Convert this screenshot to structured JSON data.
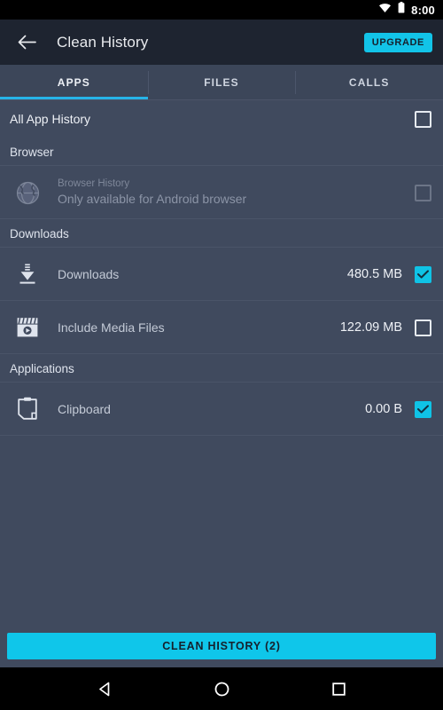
{
  "status_bar": {
    "time": "8:00",
    "wifi_icon": "wifi-icon",
    "battery_icon": "battery-icon"
  },
  "app_bar": {
    "back_icon": "back-arrow-icon",
    "title": "Clean History",
    "upgrade_label": "UPGRADE"
  },
  "tabs": {
    "active_index": 0,
    "items": [
      {
        "label": "APPS"
      },
      {
        "label": "FILES"
      },
      {
        "label": "CALLS"
      }
    ]
  },
  "all_app_history": {
    "label": "All App History",
    "checked": false
  },
  "sections": [
    {
      "header": "Browser",
      "rows": [
        {
          "icon": "globe-icon",
          "title": "Browser History",
          "subtitle": "Only available for Android browser",
          "size": "",
          "checked": false,
          "disabled": true
        }
      ]
    },
    {
      "header": "Downloads",
      "rows": [
        {
          "icon": "download-icon",
          "title": "Downloads",
          "subtitle": "",
          "size": "480.5 MB",
          "checked": true,
          "disabled": false
        },
        {
          "icon": "media-clapperboard-icon",
          "title": "Include Media Files",
          "subtitle": "",
          "size": "122.09 MB",
          "checked": false,
          "disabled": false
        }
      ]
    },
    {
      "header": "Applications",
      "rows": [
        {
          "icon": "clipboard-icon",
          "title": "Clipboard",
          "subtitle": "",
          "size": "0.00 B",
          "checked": true,
          "disabled": false
        }
      ]
    }
  ],
  "cta": {
    "label": "CLEAN HISTORY (2)"
  },
  "nav_bar": {
    "back_icon": "nav-back-triangle-icon",
    "home_icon": "nav-home-circle-icon",
    "recents_icon": "nav-recents-square-icon"
  },
  "colors": {
    "accent": "#0FC6EA",
    "appbar_bg": "#1E2430",
    "content_bg": "#404A5E",
    "tabbar_bg": "#3C4659",
    "divider": "#4A5468",
    "text_primary": "#EEF1F6",
    "text_disabled": "#7E8799"
  }
}
